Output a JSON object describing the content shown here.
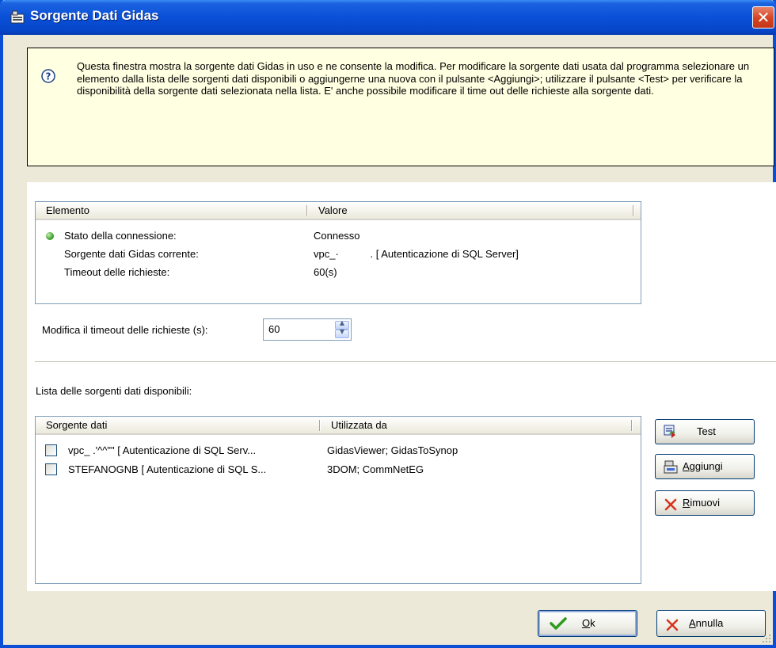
{
  "window": {
    "title": "Sorgente Dati Gidas"
  },
  "info": {
    "text": "Questa finestra mostra la sorgente dati Gidas in uso e ne consente la modifica. Per modificare la sorgente dati usata dal programma selezionare un elemento dalla lista delle sorgenti dati disponibili o aggiungerne una nuova con il pulsante <Aggiungi>; utilizzare il pulsante <Test> per verificare la disponibilità della sorgente dati selezionata nella lista. E' anche possibile modificare il time out delle richieste alla sorgente dati."
  },
  "status_list": {
    "columns": [
      "Elemento",
      "Valore"
    ],
    "rows": [
      {
        "element": "Stato della connessione:",
        "value": "Connesso"
      },
      {
        "element": "Sorgente dati Gidas corrente:",
        "value": "vpc_·           . [ Autenticazione di SQL Server]"
      },
      {
        "element": "Timeout delle richieste:",
        "value": "60(s)"
      }
    ]
  },
  "timeout": {
    "label": "Modifica il timeout delle richieste (s):",
    "value": "60"
  },
  "sources": {
    "label": "Lista delle sorgenti dati disponibili:",
    "columns": [
      "Sorgente dati",
      "Utilizzata da"
    ],
    "rows": [
      {
        "source": "vpc_  .'^^\"\" [ Autenticazione di SQL Serv...",
        "used_by": "GidasViewer; GidasToSynop",
        "checked": false
      },
      {
        "source": "STEFANOGNB [ Autenticazione di SQL S...",
        "used_by": "3DOM; CommNetEG",
        "checked": false
      }
    ]
  },
  "buttons": {
    "test": {
      "label": "Test"
    },
    "add": {
      "label_underlined": "A",
      "label_rest": "ggiungi"
    },
    "remove": {
      "label_underlined": "R",
      "label_rest": "imuovi"
    },
    "ok": {
      "label_underlined": "O",
      "label_rest": "k"
    },
    "cancel": {
      "label_underlined": "A",
      "label_rest": "nnulla"
    }
  },
  "colors": {
    "titlebar": "#0a50d8",
    "dialog_bg": "#ece9d8",
    "info_bg": "#ffffe1",
    "status_connected": "#3fa32d",
    "close": "#d54321"
  }
}
